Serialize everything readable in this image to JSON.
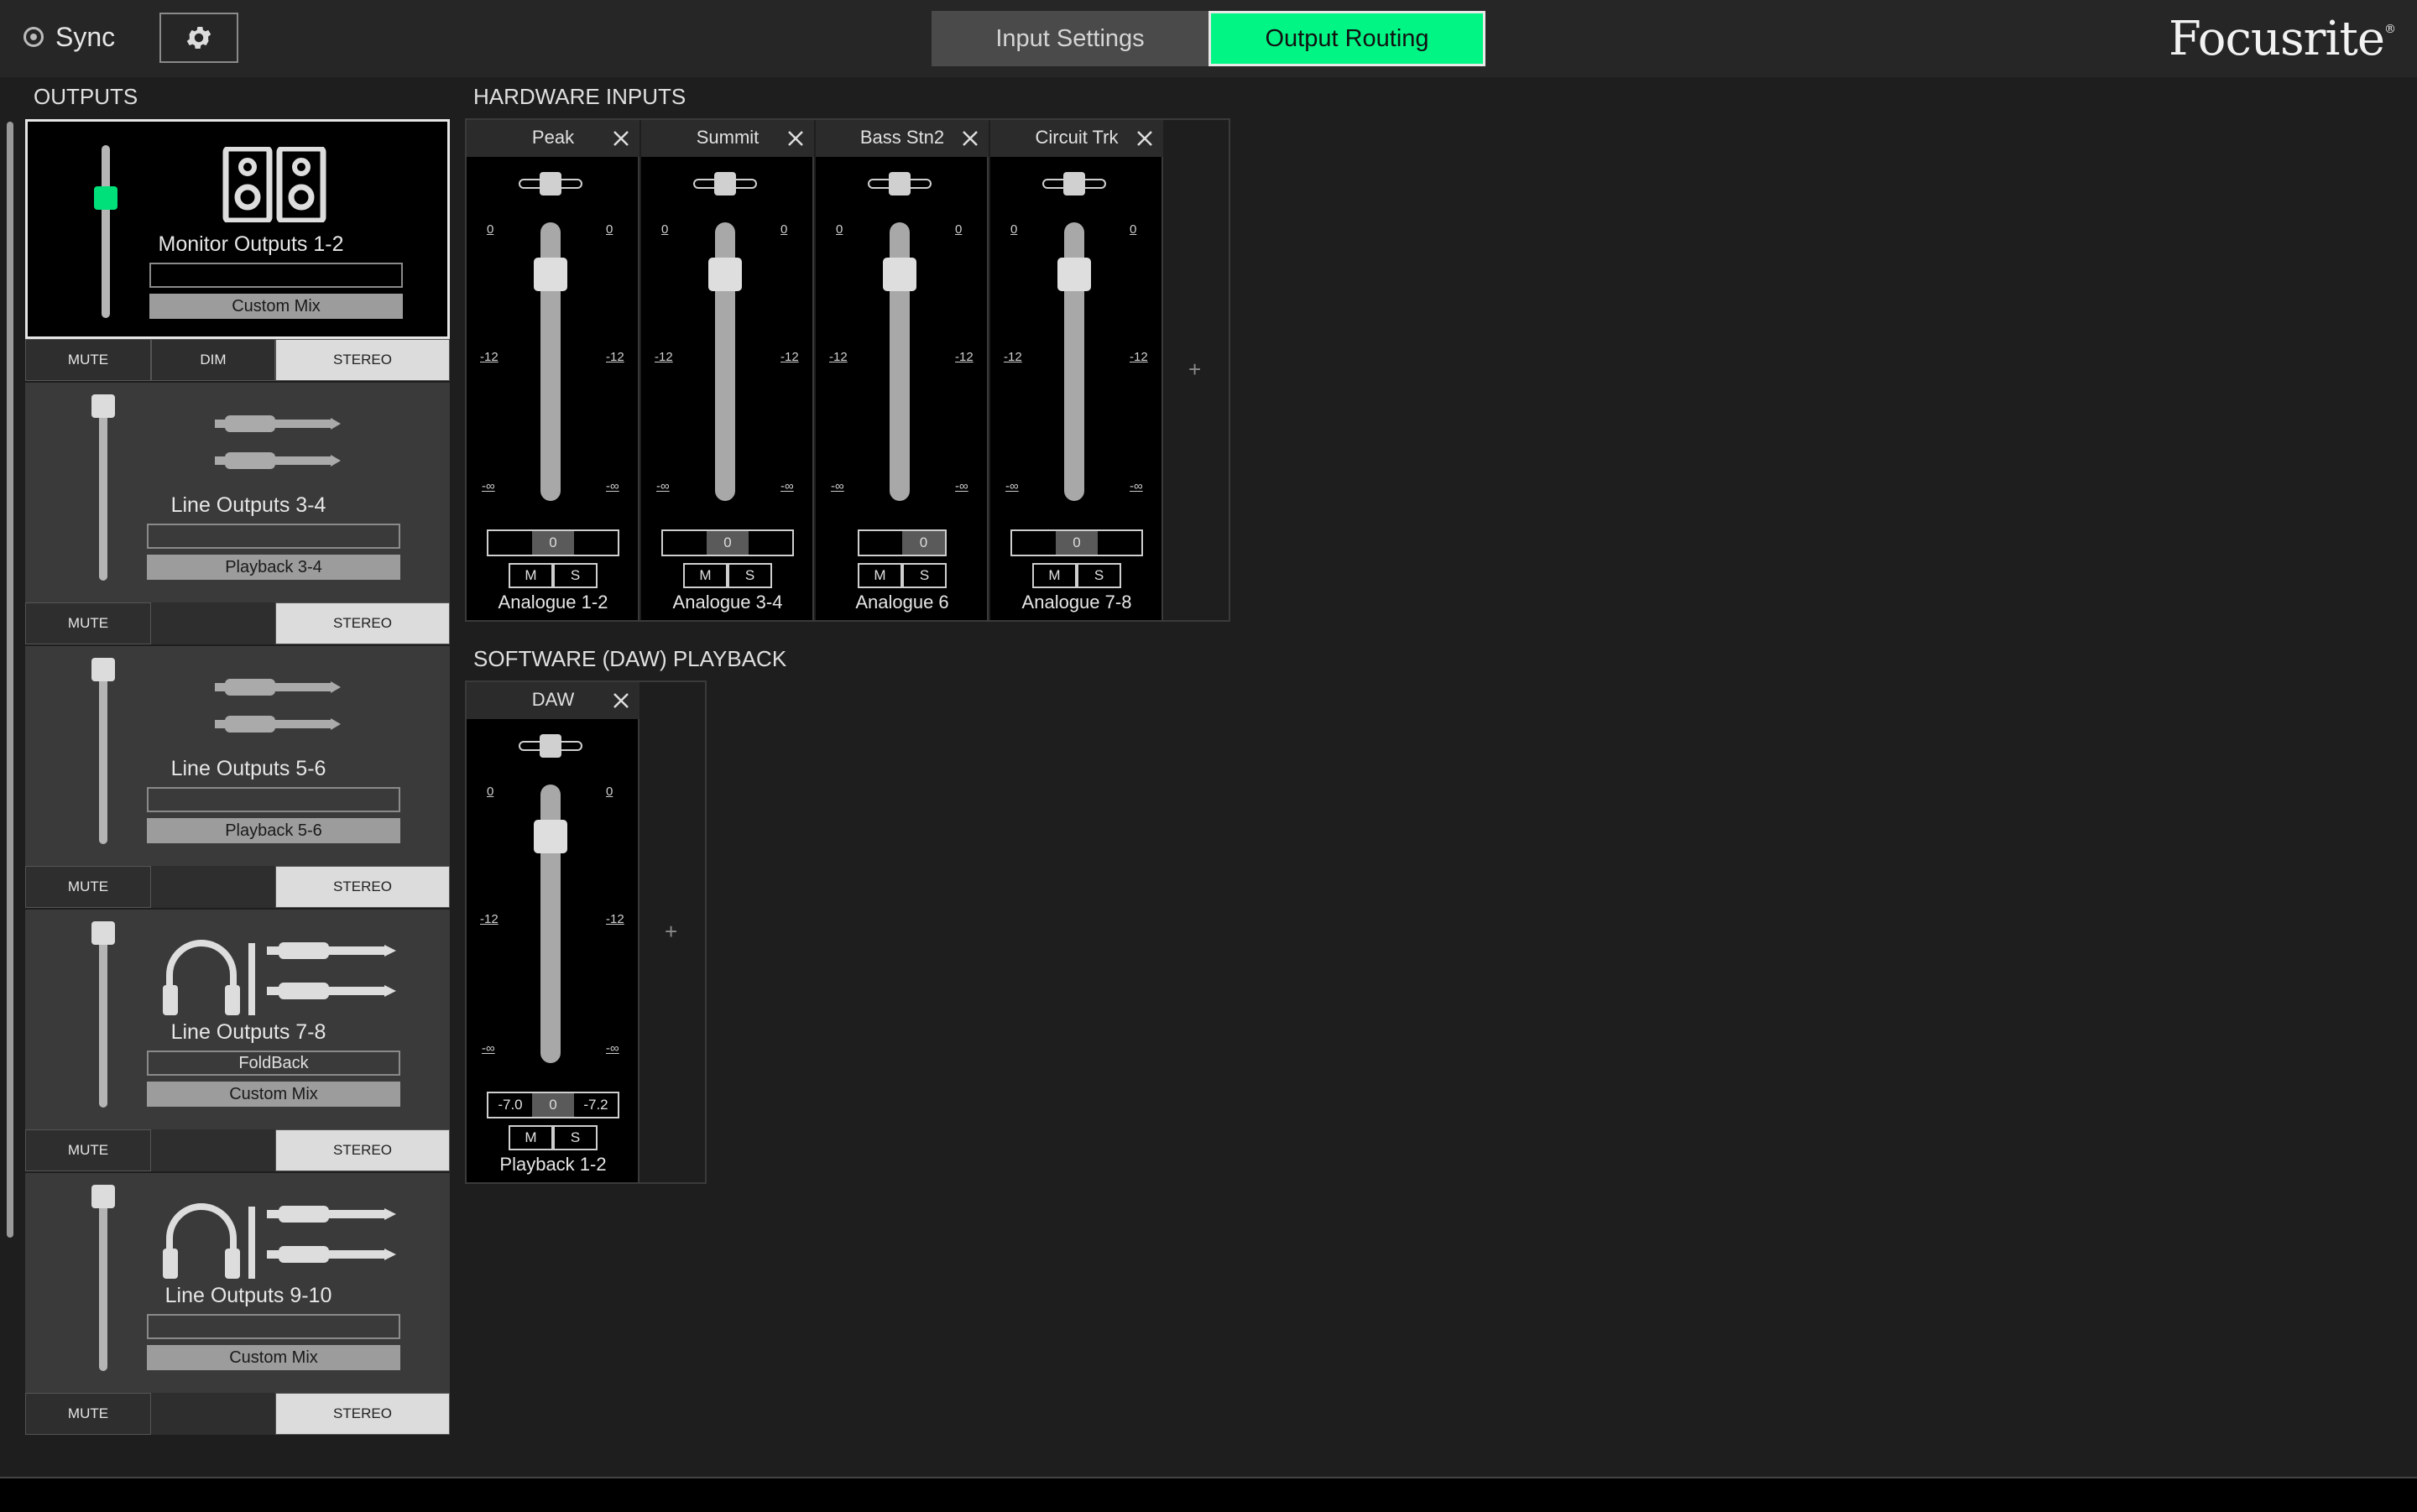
{
  "header": {
    "sync_label": "Sync",
    "tabs": [
      {
        "label": "Input Settings",
        "active": false
      },
      {
        "label": "Output Routing",
        "active": true
      }
    ],
    "logo": "Focusrite",
    "logo_mark": "®"
  },
  "outputs": {
    "title": "OUTPUTS",
    "items": [
      {
        "name": "Monitor Outputs 1-2",
        "box": "",
        "source": "Custom Mix",
        "mute": "MUTE",
        "dim": "DIM",
        "stereo": "STEREO",
        "icon": "speakers-icon",
        "level": 0.82
      },
      {
        "name": "Line Outputs 3-4",
        "box": "",
        "source": "Playback 3-4",
        "mute": "MUTE",
        "stereo": "STEREO",
        "icon": "jack-cables-icon",
        "level": 1.0
      },
      {
        "name": "Line Outputs 5-6",
        "box": "",
        "source": "Playback 5-6",
        "mute": "MUTE",
        "stereo": "STEREO",
        "icon": "jack-cables-icon",
        "level": 1.0
      },
      {
        "name": "Line Outputs 7-8",
        "box": "FoldBack",
        "source": "Custom Mix",
        "mute": "MUTE",
        "stereo": "STEREO",
        "icon": "headphones-jack-icon",
        "level": 1.0
      },
      {
        "name": "Line Outputs 9-10",
        "box": "",
        "source": "Custom Mix",
        "mute": "MUTE",
        "stereo": "STEREO",
        "icon": "headphones-jack-icon",
        "level": 1.0
      }
    ]
  },
  "hardware_inputs": {
    "title": "HARDWARE INPUTS",
    "strips": [
      {
        "name": "Peak",
        "label": "Analogue 1-2",
        "left": "",
        "center": "0",
        "right": "",
        "mute": "M",
        "solo": "S"
      },
      {
        "name": "Summit",
        "label": "Analogue 3-4",
        "left": "",
        "center": "0",
        "right": "",
        "mute": "M",
        "solo": "S"
      },
      {
        "name": "Bass Stn2",
        "label": "Analogue 6",
        "left": "",
        "center": "0",
        "right": "",
        "mute": "M",
        "solo": "S"
      },
      {
        "name": "Circuit Trk",
        "label": "Analogue 7-8",
        "left": "",
        "center": "0",
        "right": "",
        "mute": "M",
        "solo": "S"
      }
    ],
    "add": "+"
  },
  "daw": {
    "title": "SOFTWARE (DAW) PLAYBACK",
    "strips": [
      {
        "name": "DAW",
        "label": "Playback 1-2",
        "left": "-7.0",
        "center": "0",
        "right": "-7.2",
        "mute": "M",
        "solo": "S"
      }
    ],
    "add": "+"
  },
  "scale": {
    "top": "0",
    "mid": "-12",
    "bottom": "-∞"
  }
}
